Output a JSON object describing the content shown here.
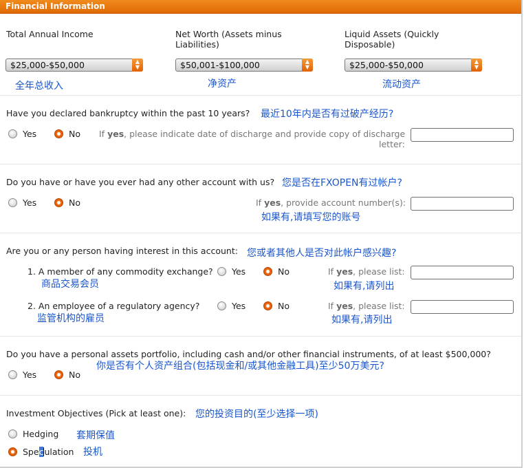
{
  "header": {
    "title": "Financial Information"
  },
  "income": {
    "total_label": "Total Annual Income",
    "total_value": "$25,000-$50,000",
    "total_cn": "全年总收入",
    "networth_label_1": "Net Worth (Assets minus",
    "networth_label_2": "Liabilities)",
    "networth_value": "$50,001-$100,000",
    "networth_cn": "净资产",
    "liquid_label_1": "Liquid Assets (Quickly",
    "liquid_label_2": "Disposable)",
    "liquid_value": "$25,000-$50,000",
    "liquid_cn": "流动资产"
  },
  "yes_label": "Yes",
  "no_label": "No",
  "bankruptcy": {
    "question": "Have you declared bankruptcy within the past 10 years?",
    "cn": "最近10年内是否有过破产经历?",
    "hint_prefix": "If ",
    "hint_bold": "yes",
    "hint_line1_rest": ", please indicate date of discharge and provide copy of discharge",
    "hint_line2": "letter:",
    "selected": "No"
  },
  "account": {
    "question": "Do you have or have you ever had any other account with us?",
    "cn": "您是否在FXOPEN有过帐户?",
    "hint_prefix": "If ",
    "hint_bold": "yes",
    "hint_rest": ", provide account number(s):",
    "hint_cn": "如果有,请填写您的账号",
    "selected": "No"
  },
  "interest": {
    "question": "Are you or any person having interest in this account:",
    "cn": "您或者其他人是否对此帐户感兴趣?",
    "item1": "1. A member of any commodity exchange?",
    "item1_cn": "商品交易会员",
    "item2": "2. An employee of a regulatory agency?",
    "item2_cn": "监管机构的雇员",
    "hint_prefix": "If ",
    "hint_bold": "yes",
    "hint_rest": ", please list:",
    "hint_cn": "如果有,请列出"
  },
  "portfolio": {
    "question": "Do you have a personal assets portfolio, including cash and/or other financial instruments, of at least $500,000?",
    "cn": "你是否有个人资产组合(包括现金和/或其他金融工具)至少50万美元?",
    "selected": "No"
  },
  "objectives": {
    "label": "Investment Objectives (Pick at least one):",
    "cn": "您的投资目的(至少选择一项)",
    "hedging": "Hedging",
    "hedging_cn": "套期保值",
    "spec_a": "Spe",
    "spec_b": "c",
    "spec_c": "ulation",
    "speculation_cn": "投机",
    "selected": "Speculation"
  }
}
